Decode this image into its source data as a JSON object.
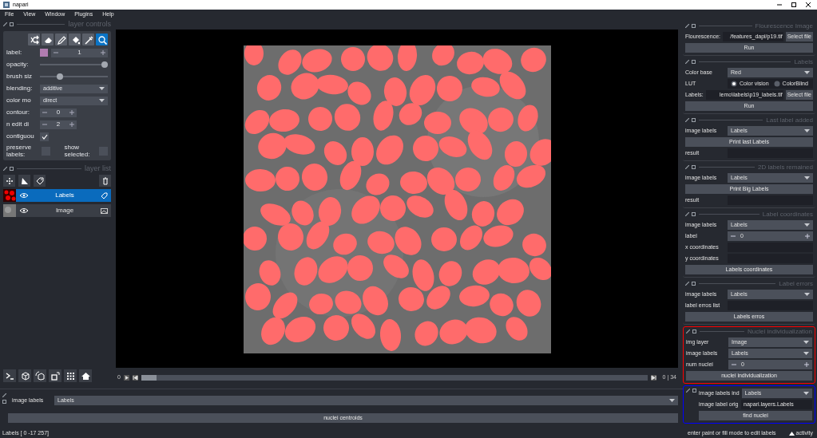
{
  "window": {
    "title": "napari"
  },
  "menu": [
    "File",
    "View",
    "Window",
    "Plugins",
    "Help"
  ],
  "layer_controls": {
    "title": "layer controls",
    "tools": [
      {
        "kind": "shuffle",
        "selected": false
      },
      {
        "kind": "eraser",
        "selected": false
      },
      {
        "kind": "pencil",
        "selected": false
      },
      {
        "kind": "fill",
        "selected": false
      },
      {
        "kind": "picker",
        "selected": false
      },
      {
        "kind": "zoom",
        "selected": true
      }
    ],
    "rows": [
      {
        "kind": "swatch_spin",
        "label": "label:",
        "color": "#b07cb0",
        "value": "1"
      },
      {
        "kind": "slider",
        "label": "opacity:",
        "level": 1
      },
      {
        "kind": "slider",
        "label": "brush siz",
        "level": 0.27
      },
      {
        "kind": "dropdown",
        "label": "blending:",
        "value": "additive"
      },
      {
        "kind": "dropdown",
        "label": "color mo",
        "value": "direct"
      },
      {
        "kind": "spin",
        "label": "contour:",
        "value": "0"
      },
      {
        "kind": "spin",
        "label": "n edit di",
        "value": "2"
      },
      {
        "kind": "checkbox",
        "label": "contiguou",
        "checked": true
      },
      {
        "kind": "checkbox_pair",
        "items": [
          {
            "label": "preserve labels:",
            "checked": false
          },
          {
            "label": "show selected:",
            "checked": false
          }
        ]
      }
    ]
  },
  "layer_list": {
    "title": "layer list",
    "layers": [
      {
        "name": "Labels",
        "kind": "labels",
        "selected": true,
        "visible": true
      },
      {
        "name": "Image",
        "kind": "image",
        "selected": false,
        "visible": true
      }
    ]
  },
  "dims": {
    "start": "0",
    "level": 0,
    "readout": "0 | 34"
  },
  "dock_widgets": [
    {
      "title": "Flourescence Image",
      "rows": [
        {
          "kind": "file",
          "label": "Flourescence:",
          "value": "/features_dapi/p19.tif",
          "button": "Select file"
        },
        {
          "kind": "button",
          "text": "Run"
        }
      ]
    },
    {
      "title": "Labels",
      "rows": [
        {
          "kind": "dropdown",
          "label": "Color base",
          "value": "Red"
        },
        {
          "kind": "radio",
          "label": "LUT",
          "options": [
            {
              "label": "Color vision",
              "selected": true
            },
            {
              "label": "ColorBlind",
              "selected": false
            }
          ]
        },
        {
          "kind": "file",
          "label": "Labels:",
          "value": "lemo\\labels\\p19_labels.tif",
          "button": "Select file"
        },
        {
          "kind": "button",
          "text": "Run"
        }
      ]
    },
    {
      "title": "Last label added",
      "rows": [
        {
          "kind": "dropdown",
          "label": "image labels",
          "value": "Labels"
        },
        {
          "kind": "button",
          "text": "Print last Labels"
        },
        {
          "kind": "output",
          "label": "result"
        }
      ]
    },
    {
      "title": "2D labels remained",
      "rows": [
        {
          "kind": "dropdown",
          "label": "image labels",
          "value": "Labels"
        },
        {
          "kind": "button",
          "text": "Print Big Labels"
        },
        {
          "kind": "output",
          "label": "result"
        }
      ]
    },
    {
      "title": "Label coordinates",
      "rows": [
        {
          "kind": "dropdown",
          "label": "image labels",
          "value": "Labels"
        },
        {
          "kind": "spin",
          "label": "label",
          "value": "0"
        },
        {
          "kind": "output",
          "label": "x coordinates"
        },
        {
          "kind": "output",
          "label": "y coordinates"
        },
        {
          "kind": "button",
          "text": "Labels coordinates"
        }
      ]
    },
    {
      "title": "Label errors",
      "rows": [
        {
          "kind": "dropdown",
          "label": "image labels",
          "value": "Labels"
        },
        {
          "kind": "output",
          "label": "label erros list"
        },
        {
          "kind": "button",
          "text": "Labels erros"
        }
      ]
    },
    {
      "title": "Nuclei individualization",
      "color": "#ff0000",
      "rows": [
        {
          "kind": "dropdown",
          "label": "img layer",
          "value": "Image"
        },
        {
          "kind": "dropdown",
          "label": "image labels",
          "value": "Labels"
        },
        {
          "kind": "spin",
          "label": "num nuclei",
          "value": "0"
        },
        {
          "kind": "button",
          "text": "nuclei individualization"
        }
      ]
    },
    {
      "color": "#0000ff",
      "rows": [
        {
          "kind": "dropdown",
          "label": "image labels ind",
          "value": "Labels"
        },
        {
          "kind": "field",
          "label": "image label orig",
          "value": "napari.layers.Labels"
        },
        {
          "kind": "button",
          "text": "find nuclei"
        }
      ]
    }
  ],
  "bottom_dock": {
    "rows": [
      {
        "kind": "dropdown",
        "label": "image labels",
        "value": "Labels"
      },
      {
        "kind": "button",
        "text": "nuclei centroids"
      }
    ]
  },
  "status_bar": {
    "layer_info": "Labels [ 0 -17 257]",
    "message": "enter paint or fill mode to edit labels",
    "activity": "activity"
  }
}
